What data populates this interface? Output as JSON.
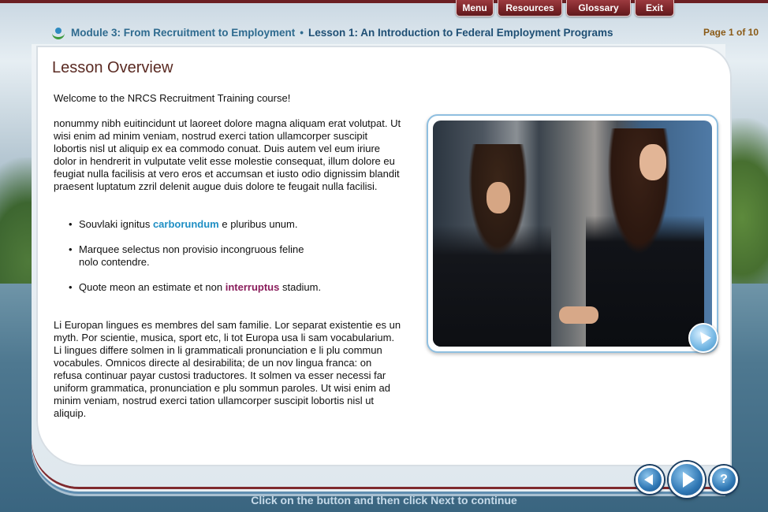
{
  "top_nav": {
    "menu": "Menu",
    "resources": "Resources",
    "glossary": "Glossary",
    "exit": "Exit"
  },
  "header": {
    "module": "Module 3: From Recruitment to Employment",
    "separator": "•",
    "lesson": "Lesson 1: An Introduction to Federal Employment Programs",
    "page_indicator": "Page 1 of 10"
  },
  "main": {
    "title": "Lesson Overview",
    "welcome": "Welcome to the NRCS Recruitment Training course!",
    "paragraph1": "nonummy nibh euitincidunt ut laoreet dolore magna aliquam erat volutpat. Ut wisi enim ad minim veniam, nostrud exerci tation ullamcorper suscipit lobortis nisl ut aliquip ex ea commodo conuat. Duis autem vel eum iriure dolor in hendrerit in vulputate velit esse molestie consequat, illum dolore eu feugiat nulla facilisis at vero eros et accumsan et iusto odio dignissim blandit praesent luptatum zzril delenit augue duis dolore te feugait nulla facilisi.",
    "bullets": [
      {
        "before": "Souvlaki ignitus ",
        "keyword": "carborundum",
        "after": " e pluribus unum."
      },
      {
        "before": "Marquee selectus non provisio incongruous feline nolo contendre.",
        "keyword": "",
        "after": ""
      },
      {
        "before": "Quote meon an estimate et non ",
        "keyword": "interruptus",
        "after": " stadium."
      }
    ],
    "paragraph2": "Li Europan lingues es membres del sam familie. Lor separat existentie es un myth. Por scientie, musica, sport etc, li tot Europa usa li sam vocabularium. Li lingues differe solmen in li grammaticali pronunciation e li plu commun vocabules. Omnicos directe al desirabilita; de un nov lingua franca: on refusa continuar payar custosi traductores. It solmen va esser necessi far uniform grammatica, pronunciation e plu sommun paroles. Ut wisi enim ad minim veniam, nostrud exerci tation ullamcorper suscipit lobortis nisl ut aliquip."
  },
  "footer": {
    "instruction": "Click on the button and then click Next to continue"
  },
  "icons": {
    "logo": "nrcs-logo-icon",
    "zoom": "enlarge-arrow-icon",
    "back": "back-arrow-icon",
    "next": "next-arrow-icon",
    "help": "help-icon"
  },
  "colors": {
    "tab": "#7a2428",
    "title": "#5a2a22",
    "keyword_blue": "#1f8fc4",
    "keyword_purple": "#8a1e5c",
    "page_indicator": "#8a5a16"
  }
}
